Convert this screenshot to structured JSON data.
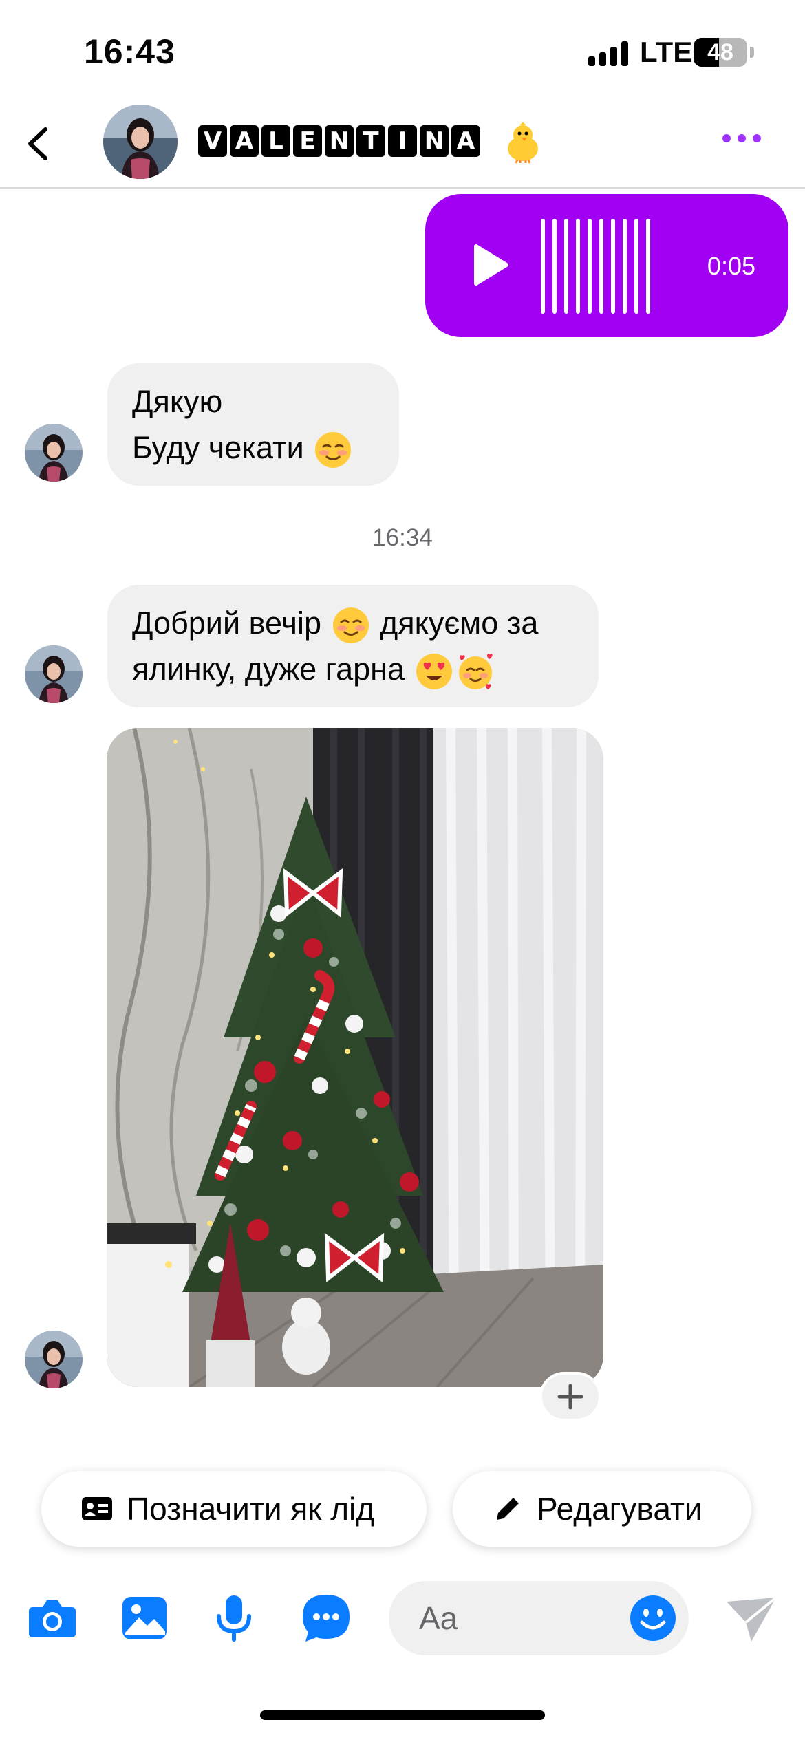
{
  "status_bar": {
    "time": "16:43",
    "network": "LTE",
    "battery": "48",
    "battery_level": 0.48
  },
  "header": {
    "contact_letters": [
      "V",
      "A",
      "L",
      "E",
      "N",
      "T",
      "I",
      "N",
      "A"
    ],
    "contact_emoji": "chick-emoji"
  },
  "messages": {
    "voice": {
      "duration": "0:05"
    },
    "reply1": {
      "line1": "Дякую",
      "line2": "Буду чекати"
    },
    "timestamp": "16:34",
    "reply2": {
      "line1_a": "Добрий вечір",
      "line1_b": "дякуємо за",
      "line2": "ялинку, дуже гарна"
    }
  },
  "actions": {
    "mark_lead": "Позначити як лід",
    "edit": "Редагувати"
  },
  "composer": {
    "placeholder": "Aa"
  },
  "colors": {
    "accent_purple": "#a100f2",
    "messenger_blue": "#0a7cff",
    "bubble_gray": "#f0f0f0"
  }
}
